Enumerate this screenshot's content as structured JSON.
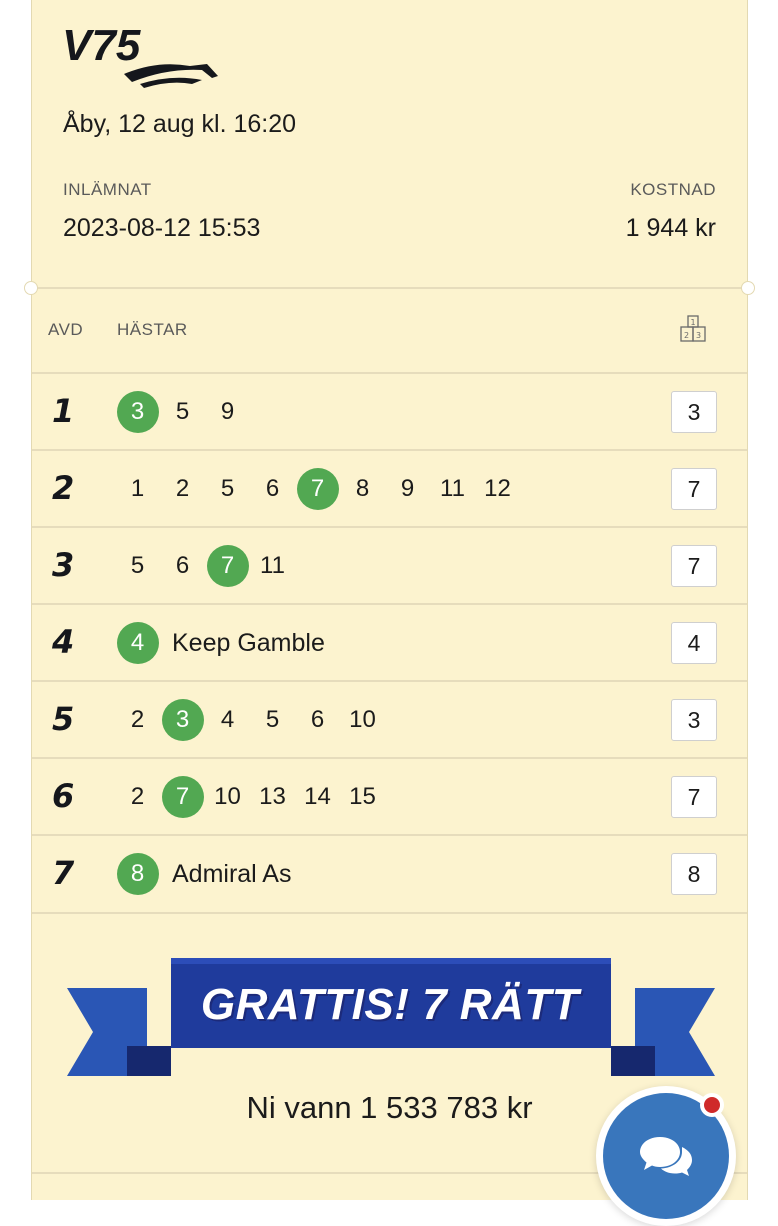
{
  "header": {
    "logo_text": "V75",
    "race_title": "Åby, 12 aug kl. 16:20",
    "submitted_label": "INLÄMNAT",
    "submitted_value": "2023-08-12 15:53",
    "cost_label": "KOSTNAD",
    "cost_value": "1 944 kr"
  },
  "table": {
    "col_race": "AVD",
    "col_horses": "HÄSTAR",
    "podium_icon": "podium-icon",
    "rows": [
      {
        "race": "1",
        "horses": [
          {
            "n": "3",
            "win": true
          },
          {
            "n": "5"
          },
          {
            "n": "9"
          }
        ],
        "name": "",
        "result": "3"
      },
      {
        "race": "2",
        "horses": [
          {
            "n": "1"
          },
          {
            "n": "2"
          },
          {
            "n": "5"
          },
          {
            "n": "6"
          },
          {
            "n": "7",
            "win": true
          },
          {
            "n": "8"
          },
          {
            "n": "9"
          },
          {
            "n": "11"
          },
          {
            "n": "12"
          }
        ],
        "name": "",
        "result": "7"
      },
      {
        "race": "3",
        "horses": [
          {
            "n": "5"
          },
          {
            "n": "6"
          },
          {
            "n": "7",
            "win": true
          },
          {
            "n": "11"
          }
        ],
        "name": "",
        "result": "7"
      },
      {
        "race": "4",
        "horses": [
          {
            "n": "4",
            "win": true
          }
        ],
        "name": "Keep Gamble",
        "result": "4"
      },
      {
        "race": "5",
        "horses": [
          {
            "n": "2"
          },
          {
            "n": "3",
            "win": true
          },
          {
            "n": "4"
          },
          {
            "n": "5"
          },
          {
            "n": "6"
          },
          {
            "n": "10"
          }
        ],
        "name": "",
        "result": "3"
      },
      {
        "race": "6",
        "horses": [
          {
            "n": "2"
          },
          {
            "n": "7",
            "win": true
          },
          {
            "n": "10"
          },
          {
            "n": "13"
          },
          {
            "n": "14"
          },
          {
            "n": "15"
          }
        ],
        "name": "",
        "result": "7"
      },
      {
        "race": "7",
        "horses": [
          {
            "n": "8",
            "win": true
          }
        ],
        "name": "Admiral As",
        "result": "8"
      }
    ]
  },
  "result": {
    "banner_text": "GRATTIS! 7 RÄTT",
    "prize_text": "Ni vann 1 533 783 kr"
  },
  "chat": {
    "icon": "chat-bubbles-icon",
    "has_notification": true
  },
  "colors": {
    "card_bg": "#fcf3cf",
    "winner_green": "#52a852",
    "banner_blue": "#1f3b9c",
    "chat_blue": "#3976bc",
    "notification_red": "#cf2a2a"
  }
}
